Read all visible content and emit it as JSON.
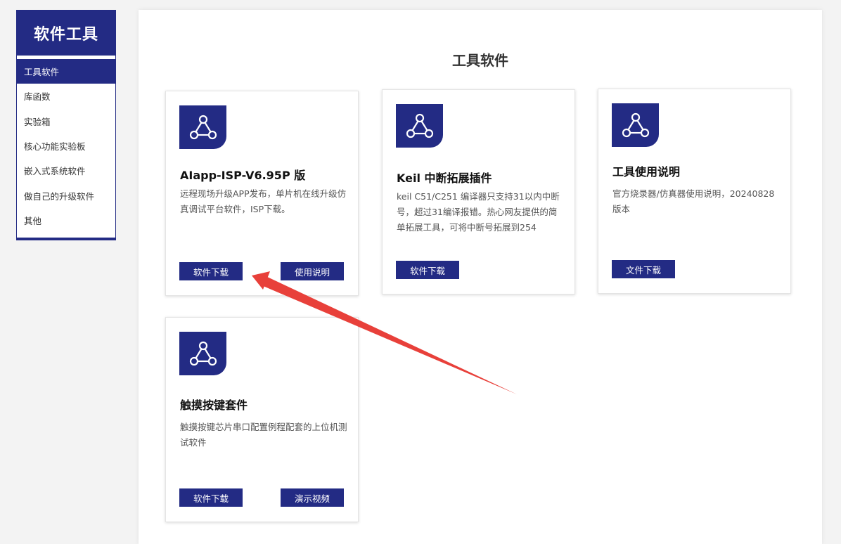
{
  "sidebar": {
    "title": "软件工具",
    "items": [
      {
        "label": "工具软件",
        "active": true
      },
      {
        "label": "库函数",
        "active": false
      },
      {
        "label": "实验箱",
        "active": false
      },
      {
        "label": "核心功能实验板",
        "active": false
      },
      {
        "label": "嵌入式系统软件",
        "active": false
      },
      {
        "label": "做自己的升级软件",
        "active": false
      },
      {
        "label": "其他",
        "active": false
      }
    ]
  },
  "main": {
    "title": "工具软件",
    "cards": [
      {
        "icon": "network-icon",
        "title": "AIapp-ISP-V6.95P 版",
        "desc": "远程现场升级APP发布，单片机在线升级仿真调试平台软件，ISP下载。",
        "buttons": [
          "软件下载",
          "使用说明"
        ]
      },
      {
        "icon": "network-icon",
        "title": "Keil 中断拓展插件",
        "desc": "keil C51/C251 编译器只支持31以内中断号，超过31编译报错。热心网友提供的简单拓展工具，可将中断号拓展到254",
        "buttons": [
          "软件下载"
        ]
      },
      {
        "icon": "network-icon",
        "title": "工具使用说明",
        "desc": "官方烧录器/仿真器使用说明，20240828版本",
        "buttons": [
          "文件下载"
        ]
      },
      {
        "icon": "network-icon",
        "title": "触摸按键套件",
        "desc": "触摸按键芯片串口配置例程配套的上位机测试软件",
        "buttons": [
          "软件下载",
          "演示视频"
        ]
      }
    ]
  },
  "colors": {
    "brand": "#232b84",
    "annotation_arrow": "#e8403a"
  }
}
